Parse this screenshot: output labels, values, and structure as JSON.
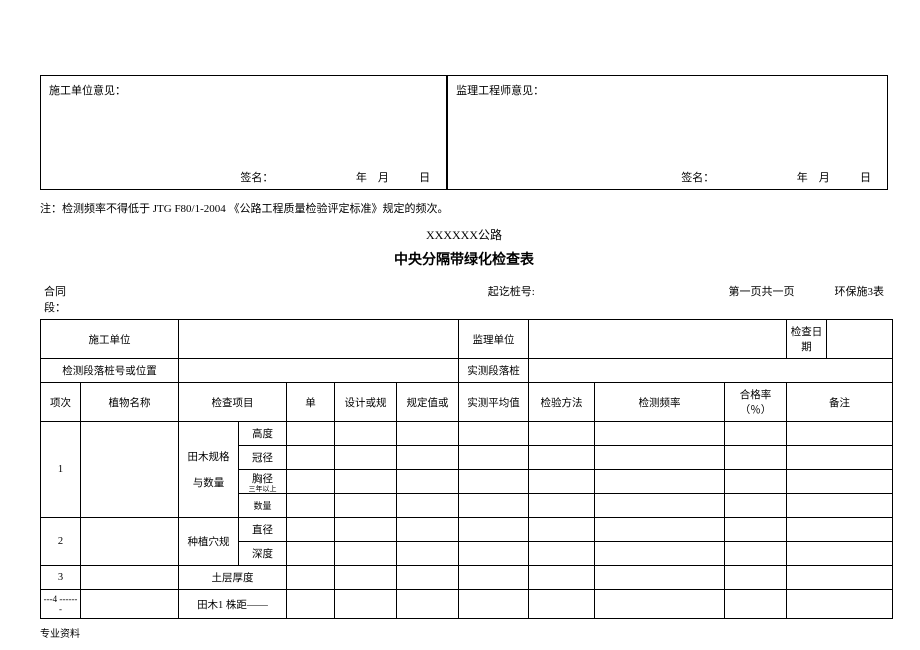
{
  "topLeft": {
    "heading": "施工单位意见：",
    "signature": "签名：                              年    月           日"
  },
  "topRight": {
    "heading": "监理工程师意见：",
    "signature": "签名：                              年    月           日"
  },
  "note": "注：检测频率不得低于  JTG F80/1-2004 《公路工程质量检验评定标准》规定的频次。",
  "road": "XXXXXX公路",
  "title": "中央分隔带绿化检查表",
  "meta": {
    "contract": "合同\n段：",
    "station": "起讫桩号:",
    "page": "第一页共一页",
    "formId": "环保施3表"
  },
  "hdr": {
    "unit": "施工单位",
    "supervisor": "监理单位",
    "date": "检查日期",
    "stake": "检测段落桩号或位置",
    "realStake": "实测段落桩",
    "seq": "项次",
    "plant": "植物名称",
    "item": "检查项目",
    "unitCol": "单",
    "design": "设计或规",
    "spec": "规定值或",
    "measured": "实测平均值",
    "method": "检验方法",
    "freq": "检测频率",
    "pass": "合格率（％）",
    "remark": "备注"
  },
  "rows": {
    "r1": {
      "num": "1",
      "group": "田木规格\n\n与数量",
      "a": "高度",
      "b": "冠径",
      "c": "胸径",
      "c2": "三年以上",
      "d": "数量"
    },
    "r2": {
      "num": "2",
      "group": "种植穴规",
      "a": "直径",
      "b": "深度"
    },
    "r3": {
      "num": "3",
      "group": "土层厚度"
    },
    "r4": {
      "num": "---4 -------",
      "group": "田木1 株距——"
    }
  },
  "footer": "专业资料"
}
